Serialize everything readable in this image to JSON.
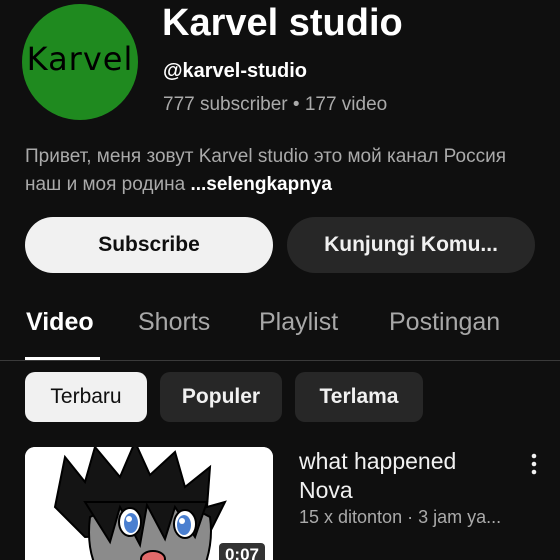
{
  "channel": {
    "avatar_text": "Karvel",
    "name": "Karvel studio",
    "handle": "@karvel-studio",
    "stats": "777 subscriber • 177 video",
    "description": "Привет, меня зовут Karvel studio это мой канал Россия наш и моя родина ",
    "more_label": "...selengkapnya",
    "avatar_color": "#1f8a1f"
  },
  "actions": {
    "subscribe_label": "Subscribe",
    "community_label": "Kunjungi Komu..."
  },
  "tabs": [
    {
      "label": "Video",
      "active": true
    },
    {
      "label": "Shorts",
      "active": false
    },
    {
      "label": "Playlist",
      "active": false
    },
    {
      "label": "Postingan",
      "active": false
    }
  ],
  "chips": [
    {
      "label": "Terbaru",
      "selected": true
    },
    {
      "label": "Populer",
      "selected": false
    },
    {
      "label": "Terlama",
      "selected": false
    }
  ],
  "videos": [
    {
      "title": "what happened Nova",
      "meta": "15 x ditonton · 3 jam ya...",
      "duration": "0:07",
      "menu_icon": "more-vert-icon"
    }
  ],
  "colors": {
    "background": "#0f0f0f",
    "text_primary": "#f1f1f1",
    "text_secondary": "#aaaaaa",
    "chip_bg": "#272727"
  }
}
